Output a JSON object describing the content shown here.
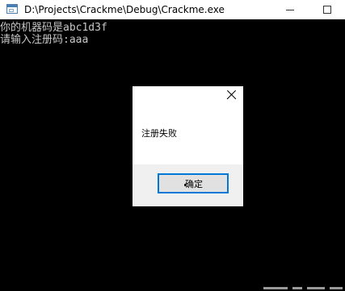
{
  "window": {
    "title": "D:\\Projects\\Crackme\\Debug\\Crackme.exe",
    "icon": "console-window-icon"
  },
  "console": {
    "lines": [
      "你的机器码是abc1d3f",
      "请输入注册码:aaa"
    ]
  },
  "message_box": {
    "text": "注册失败",
    "ok_label": "确定"
  },
  "colors": {
    "console_bg": "#000000",
    "console_text": "#c8c8c8",
    "focus_border": "#0078d7"
  }
}
